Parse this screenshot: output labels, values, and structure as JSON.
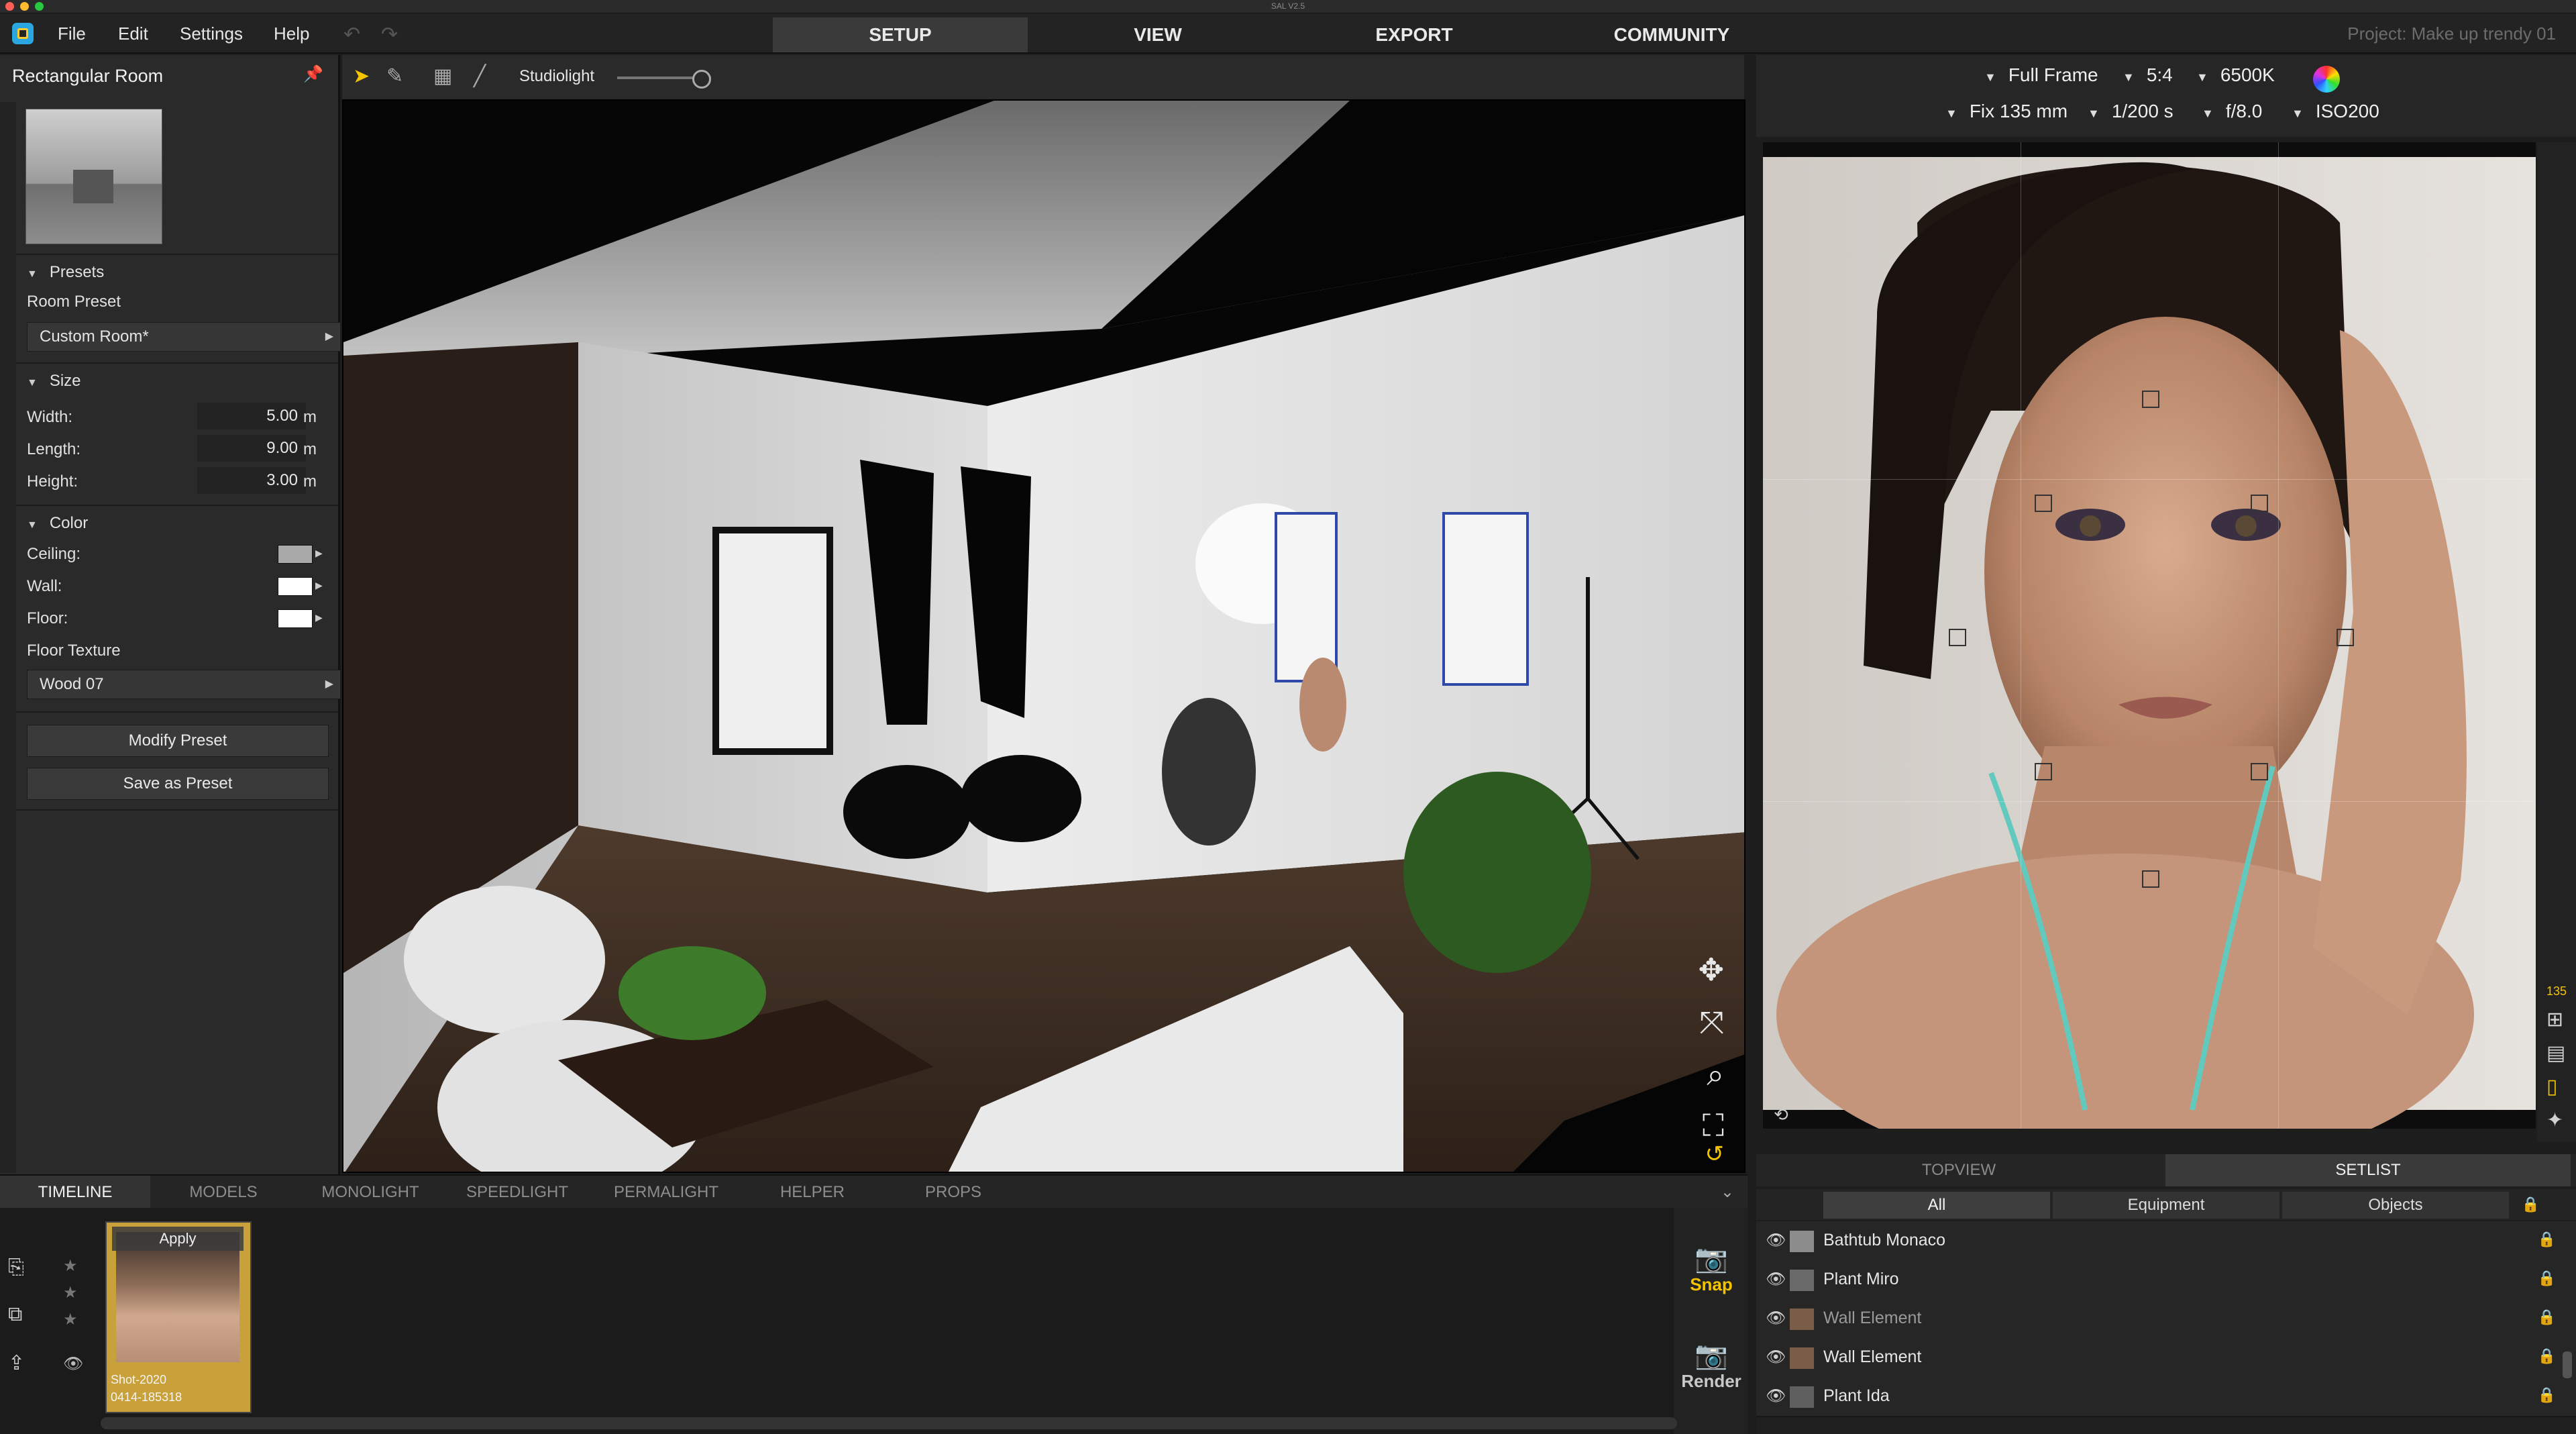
{
  "titlebar": {
    "title": "SAL V2.5"
  },
  "menu": {
    "file": "File",
    "edit": "Edit",
    "settings": "Settings",
    "help": "Help"
  },
  "main_tabs": [
    "SETUP",
    "VIEW",
    "EXPORT",
    "COMMUNITY"
  ],
  "project": "Project: Make up trendy 01",
  "left_panel": {
    "title": "Rectangular Room",
    "presets": {
      "header": "Presets",
      "room_preset_label": "Room Preset",
      "room_preset_value": "Custom Room*"
    },
    "size": {
      "header": "Size",
      "width_label": "Width:",
      "width_value": "5.00",
      "length_label": "Length:",
      "length_value": "9.00",
      "height_label": "Height:",
      "height_value": "3.00",
      "unit": "m"
    },
    "color": {
      "header": "Color",
      "ceiling_label": "Ceiling:",
      "wall_label": "Wall:",
      "floor_label": "Floor:",
      "ceiling_color": "#a9a9a9",
      "wall_color": "#ffffff",
      "floor_color": "#ffffff",
      "floor_texture_label": "Floor Texture",
      "floor_texture_value": "Wood 07"
    },
    "modify_preset": "Modify Preset",
    "save_as_preset": "Save as Preset"
  },
  "viewport_toolbar": {
    "studiolight_label": "Studiolight",
    "studiolight_level": 0.9
  },
  "camera": {
    "frame": "Full Frame",
    "aspect": "5:4",
    "white_balance": "6500K",
    "lens": "Fix 135 mm",
    "shutter": "1/200 s",
    "aperture": "f/8.0",
    "iso": "ISO200"
  },
  "preview_side": {
    "focal_readout": "135"
  },
  "right_tabs": [
    "TOPVIEW",
    "SETLIST"
  ],
  "setlist_filters": [
    "All",
    "Equipment",
    "Objects"
  ],
  "setlist": [
    {
      "name": "Bathtub Monaco",
      "dim": false
    },
    {
      "name": "Plant Miro",
      "dim": false
    },
    {
      "name": "Wall Element",
      "dim": true
    },
    {
      "name": "Wall Element",
      "dim": false
    },
    {
      "name": "Plant Ida",
      "dim": false
    }
  ],
  "bottom_tabs": [
    "TIMELINE",
    "MODELS",
    "MONOLIGHT",
    "SPEEDLIGHT",
    "PERMALIGHT",
    "HELPER",
    "PROPS"
  ],
  "timeline": {
    "apply": "Apply",
    "shot_line1": "Shot-2020",
    "shot_line2": "0414-185318",
    "snap": "Snap",
    "render": "Render"
  }
}
